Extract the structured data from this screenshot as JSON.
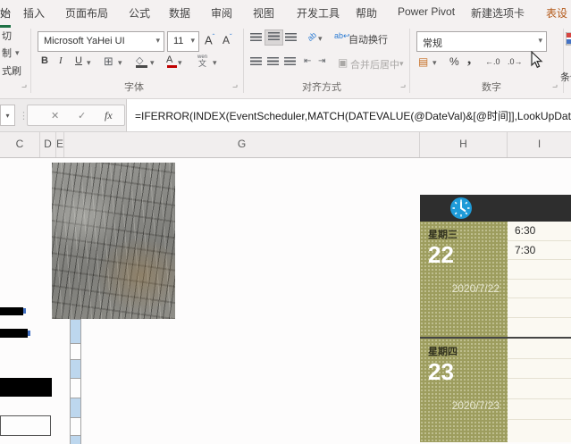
{
  "ribbon": {
    "tabs": [
      "始",
      "插入",
      "页面布局",
      "公式",
      "数据",
      "审阅",
      "视图",
      "开发工具",
      "帮助",
      "Power Pivot",
      "新建选项卡",
      "表设"
    ],
    "clipboard": {
      "cut": "切",
      "copy": "制",
      "format_painter": "式刷"
    },
    "font": {
      "group_label": "字体",
      "name": "Microsoft YaHei UI",
      "size": "11",
      "bold": "B",
      "italic": "I",
      "underline": "U",
      "grow": "A",
      "shrink": "A",
      "color_btn": "A",
      "phonetic": "文",
      "phonetic_small": "wen"
    },
    "alignment": {
      "group_label": "对齐方式",
      "wrap_text": "自动换行",
      "merge_center": "合并后居中",
      "orientation": "ab",
      "wrap_icon": "ab"
    },
    "number": {
      "group_label": "数字",
      "format": "常规",
      "percent": "%",
      "comma": ",",
      "increase_decimal": "←.0",
      "decrease_decimal": ".0→"
    },
    "styles": {
      "conditional_partial": "条件"
    }
  },
  "formula_bar": {
    "fx": "fx",
    "cancel": "✕",
    "enter": "✓",
    "formula": "=IFERROR(INDEX(EventScheduler,MATCH(DATEVALUE(@DateVal)&[@时间]],LookUpDateAn"
  },
  "sheet": {
    "columns": [
      "C",
      "D",
      "E",
      "G",
      "H",
      "I"
    ]
  },
  "calendar": {
    "day1": {
      "weekday": "星期三",
      "day": "22",
      "date": "2020/7/22"
    },
    "day1_times": [
      "6:30",
      "7:30",
      "",
      "",
      "",
      ""
    ],
    "day2": {
      "weekday": "星期四",
      "day": "23",
      "date": "2020/7/23"
    },
    "day2_times": [
      "",
      "",
      "",
      "",
      ""
    ]
  },
  "icons": {
    "dropdown": "▾",
    "dots": "⋮",
    "borders": "⊞",
    "fill": "◇",
    "merge": "▣",
    "launcher": "⌐",
    "caret_up": "ˆ",
    "caret_down": "ˇ",
    "wrap_arrow": "↩",
    "indent_left": "⇤",
    "indent_right": "⇥",
    "number_format": "▤"
  },
  "colors": {
    "tab_accent_green": "#1e7145",
    "table_design_text": "#b35919",
    "calendar_olive": "#9d9d5e",
    "calendar_header": "#2e2e2e",
    "clock_blue": "#1f9bd8",
    "cell_highlight_blue": "#bdd7ee"
  }
}
